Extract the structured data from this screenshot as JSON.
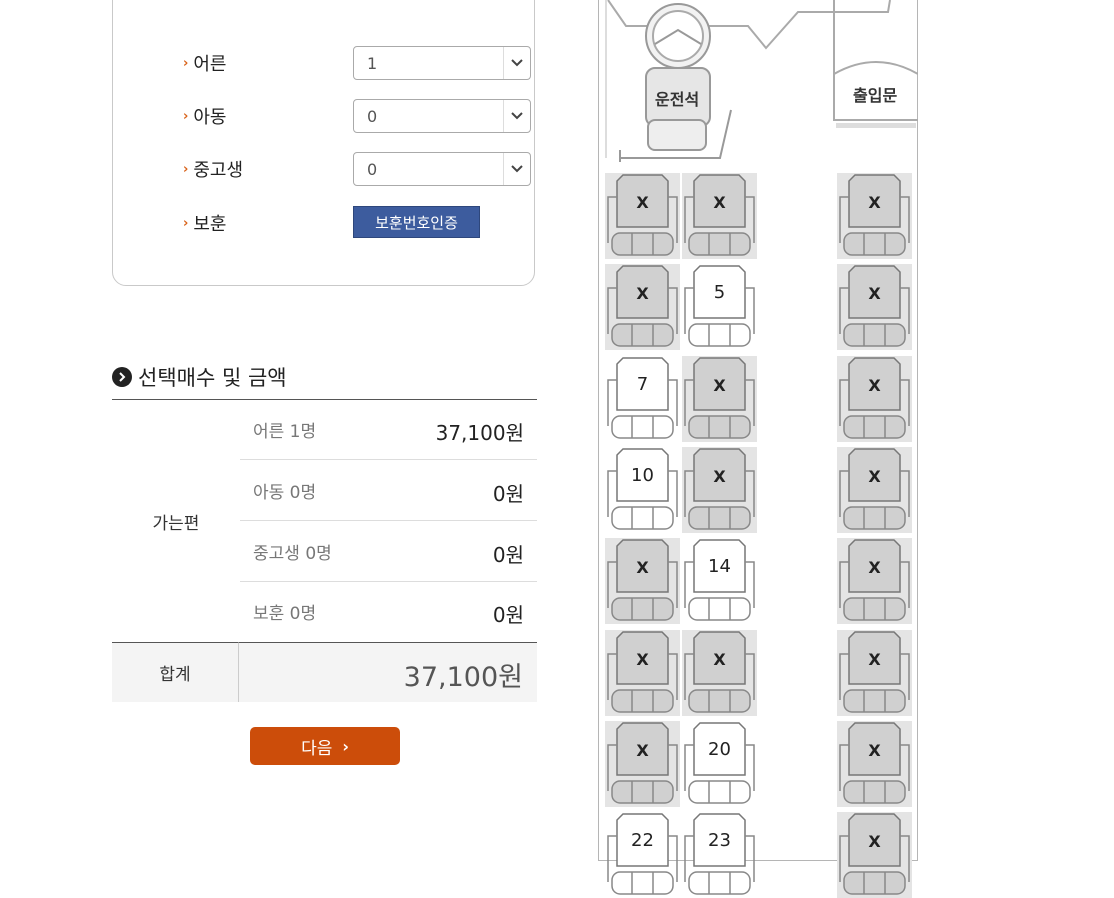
{
  "passengers": {
    "rows": [
      {
        "label": "어른",
        "value": "1"
      },
      {
        "label": "아동",
        "value": "0"
      },
      {
        "label": "중고생",
        "value": "0"
      }
    ],
    "veteran_label": "보훈",
    "veteran_button": "보훈번호인증"
  },
  "summary": {
    "title": "선택매수 및 금액",
    "route_label": "가는편",
    "lines": [
      {
        "label": "어른 1명",
        "amount": "37,100원"
      },
      {
        "label": "아동 0명",
        "amount": "0원"
      },
      {
        "label": "중고생 0명",
        "amount": "0원"
      },
      {
        "label": "보훈 0명",
        "amount": "0원"
      }
    ],
    "total_label": "합계",
    "total_amount": "37,100원"
  },
  "next_button": "다음",
  "bus": {
    "driver_label": "운전석",
    "door_label": "출입문",
    "seats": [
      {
        "row": 0,
        "col": 0,
        "label": "X",
        "available": false
      },
      {
        "row": 0,
        "col": 1,
        "label": "X",
        "available": false
      },
      {
        "row": 0,
        "col": 2,
        "label": "X",
        "available": false
      },
      {
        "row": 1,
        "col": 0,
        "label": "X",
        "available": false
      },
      {
        "row": 1,
        "col": 1,
        "label": "5",
        "available": true
      },
      {
        "row": 1,
        "col": 2,
        "label": "X",
        "available": false
      },
      {
        "row": 2,
        "col": 0,
        "label": "7",
        "available": true
      },
      {
        "row": 2,
        "col": 1,
        "label": "X",
        "available": false
      },
      {
        "row": 2,
        "col": 2,
        "label": "X",
        "available": false
      },
      {
        "row": 3,
        "col": 0,
        "label": "10",
        "available": true
      },
      {
        "row": 3,
        "col": 1,
        "label": "X",
        "available": false
      },
      {
        "row": 3,
        "col": 2,
        "label": "X",
        "available": false
      },
      {
        "row": 4,
        "col": 0,
        "label": "X",
        "available": false
      },
      {
        "row": 4,
        "col": 1,
        "label": "14",
        "available": true
      },
      {
        "row": 4,
        "col": 2,
        "label": "X",
        "available": false
      },
      {
        "row": 5,
        "col": 0,
        "label": "X",
        "available": false
      },
      {
        "row": 5,
        "col": 1,
        "label": "X",
        "available": false
      },
      {
        "row": 5,
        "col": 2,
        "label": "X",
        "available": false
      },
      {
        "row": 6,
        "col": 0,
        "label": "X",
        "available": false
      },
      {
        "row": 6,
        "col": 1,
        "label": "20",
        "available": true
      },
      {
        "row": 6,
        "col": 2,
        "label": "X",
        "available": false
      },
      {
        "row": 7,
        "col": 0,
        "label": "22",
        "available": true
      },
      {
        "row": 7,
        "col": 1,
        "label": "23",
        "available": true
      },
      {
        "row": 7,
        "col": 2,
        "label": "X",
        "available": false
      }
    ]
  },
  "colors": {
    "accent": "#cc4d0a",
    "verify": "#3d5c9e",
    "taken_seat": "#d9d9d9",
    "arrow": "#d9641c"
  }
}
